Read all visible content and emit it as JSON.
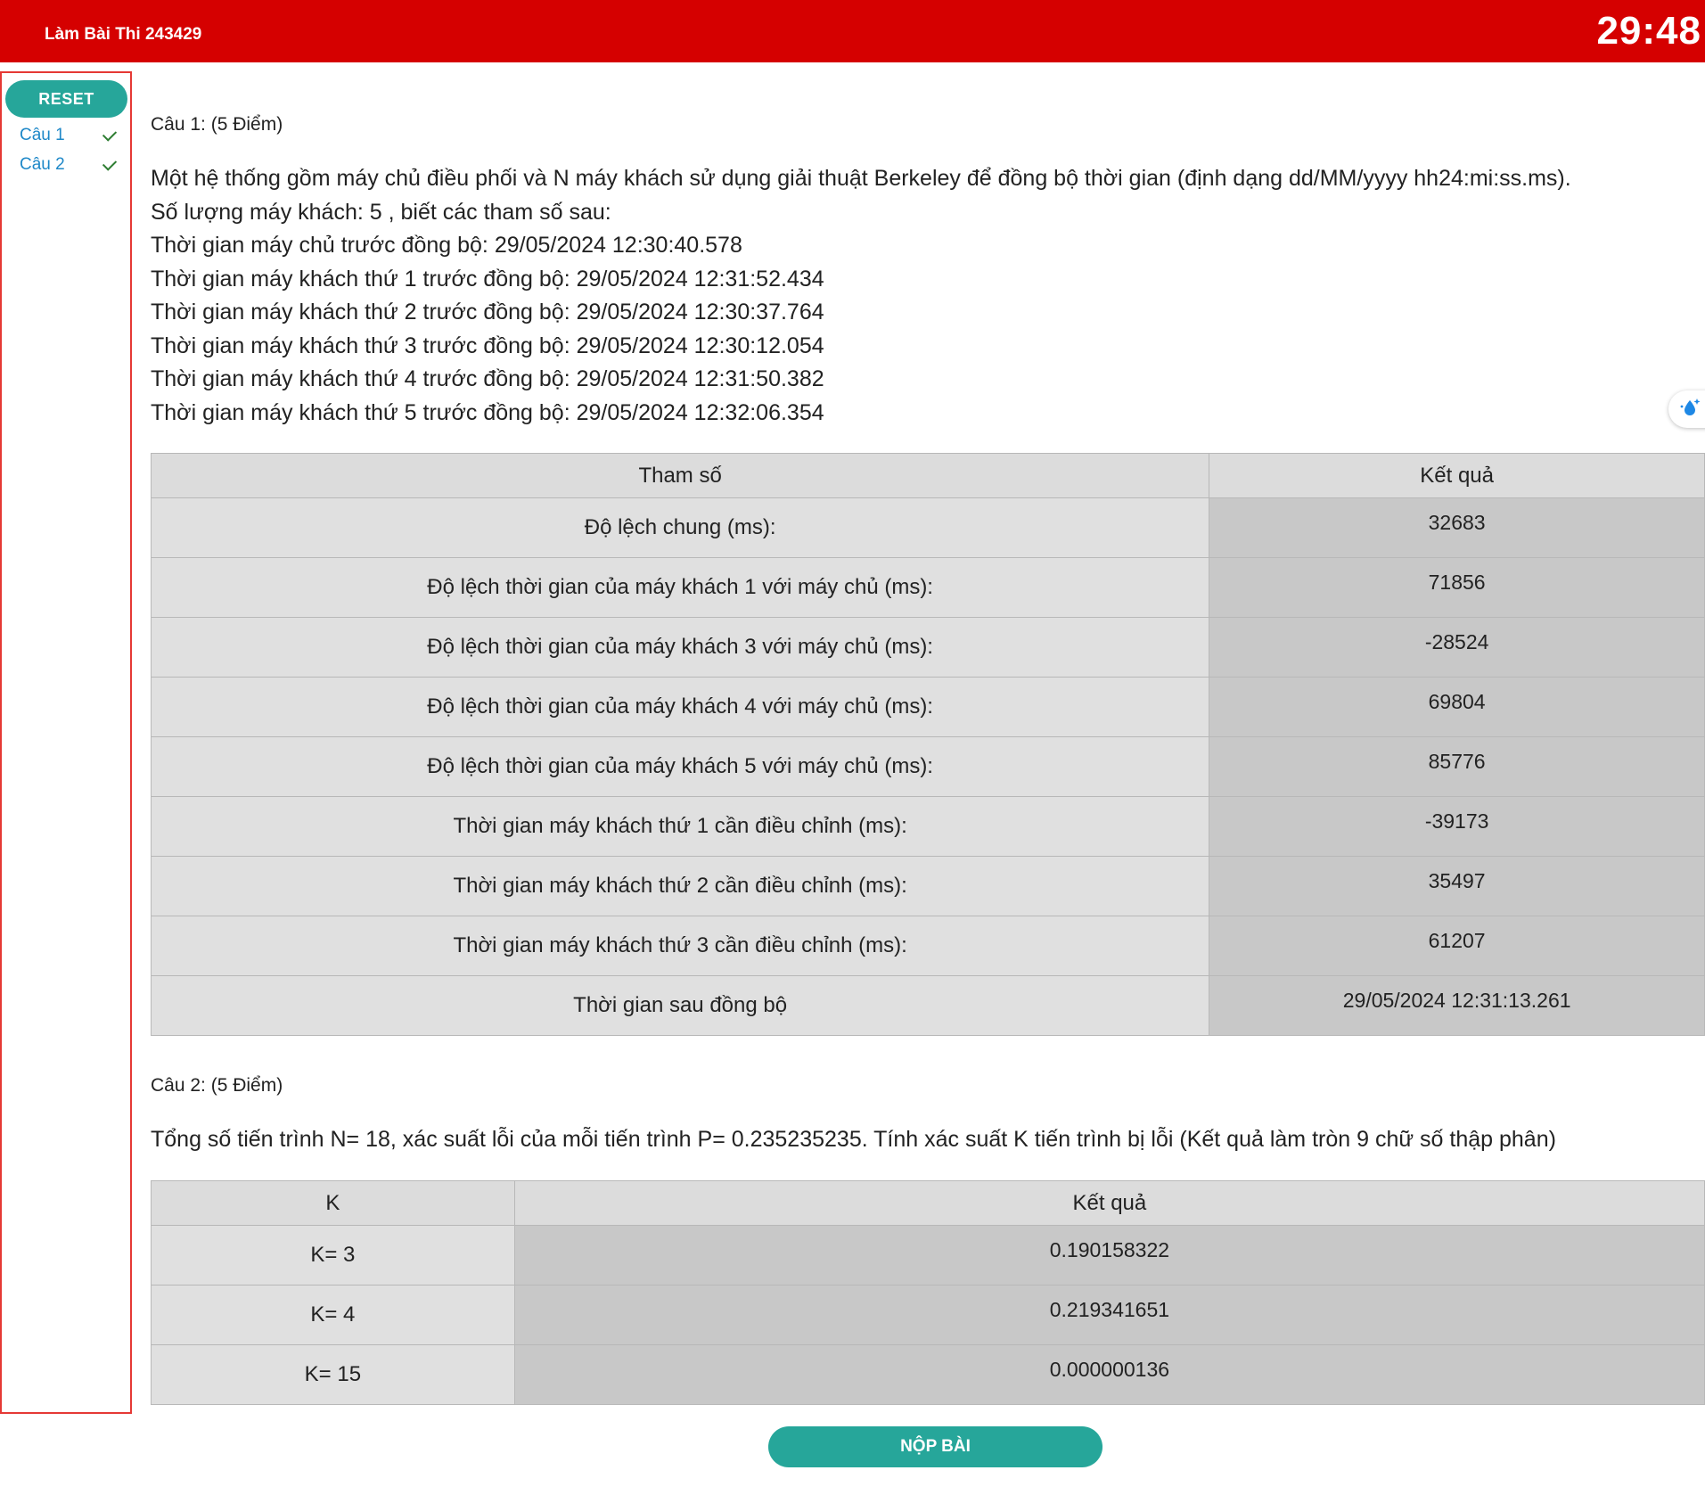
{
  "header": {
    "title": "Làm Bài Thi 243429",
    "timer": "29:48"
  },
  "sidebar": {
    "reset_label": "RESET",
    "questions": [
      {
        "label": "Câu 1",
        "answered": true
      },
      {
        "label": "Câu 2",
        "answered": true
      }
    ]
  },
  "q1": {
    "header": "Câu 1: (5 Điểm)",
    "lines": [
      "Một hệ thống gồm máy chủ điều phối và N máy khách sử dụng giải thuật Berkeley để đồng bộ thời gian (định dạng dd/MM/yyyy hh24:mi:ss.ms).",
      "Số lượng máy khách: 5 , biết các tham số sau:",
      "Thời gian máy chủ trước đồng bộ: 29/05/2024 12:30:40.578",
      "Thời gian máy khách thứ 1 trước đồng bộ: 29/05/2024 12:31:52.434",
      "Thời gian máy khách thứ 2 trước đồng bộ: 29/05/2024 12:30:37.764",
      "Thời gian máy khách thứ 3 trước đồng bộ: 29/05/2024 12:30:12.054",
      "Thời gian máy khách thứ 4 trước đồng bộ: 29/05/2024 12:31:50.382",
      "Thời gian máy khách thứ 5 trước đồng bộ: 29/05/2024 12:32:06.354"
    ],
    "table": {
      "col_param": "Tham số",
      "col_result": "Kết quả",
      "rows": [
        {
          "label": "Độ lệch chung (ms):",
          "value": "32683"
        },
        {
          "label": "Độ lệch thời gian của máy khách 1 với máy chủ (ms):",
          "value": "71856"
        },
        {
          "label": "Độ lệch thời gian của máy khách 3 với máy chủ (ms):",
          "value": "-28524"
        },
        {
          "label": "Độ lệch thời gian của máy khách 4 với máy chủ (ms):",
          "value": "69804"
        },
        {
          "label": "Độ lệch thời gian của máy khách 5 với máy chủ (ms):",
          "value": "85776"
        },
        {
          "label": "Thời gian máy khách thứ 1 cần điều chỉnh (ms):",
          "value": "-39173"
        },
        {
          "label": "Thời gian máy khách thứ 2 cần điều chỉnh (ms):",
          "value": "35497"
        },
        {
          "label": "Thời gian máy khách thứ 3 cần điều chỉnh (ms):",
          "value": "61207"
        },
        {
          "label": "Thời gian sau đồng bộ",
          "value": "29/05/2024 12:31:13.261"
        }
      ]
    }
  },
  "q2": {
    "header": "Câu 2: (5 Điểm)",
    "text": "Tổng số tiến trình N= 18, xác suất lỗi của mỗi tiến trình P= 0.235235235. Tính xác suất K tiến trình bị lỗi (Kết quả làm tròn 9 chữ số thập phân)",
    "table": {
      "col_k": "K",
      "col_result": "Kết quả",
      "rows": [
        {
          "label": "K= 3",
          "value": "0.190158322"
        },
        {
          "label": "K= 4",
          "value": "0.219341651"
        },
        {
          "label": "K= 15",
          "value": "0.000000136"
        }
      ]
    }
  },
  "submit_label": "NỘP BÀI",
  "colors": {
    "header_bg": "#d50000",
    "button": "#26a69a",
    "nav_link": "#1e88c8",
    "check": "#2e7d32"
  },
  "icons": {
    "answered": "check-icon",
    "floating": "water-drop-sparkle-icon"
  }
}
